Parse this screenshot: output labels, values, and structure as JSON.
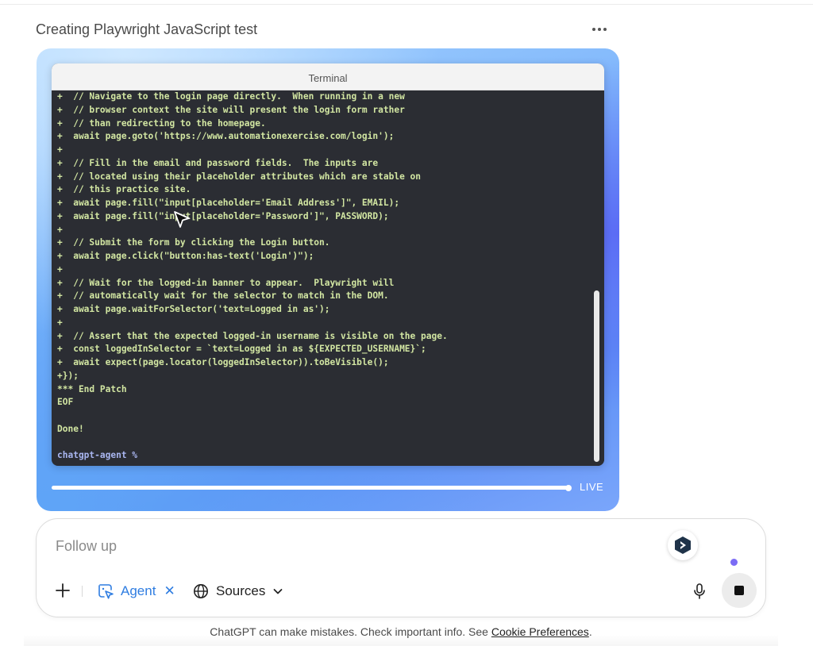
{
  "header": {
    "title": "Creating Playwright JavaScript test",
    "more_icon": "more-horizontal-icon"
  },
  "terminal": {
    "title": "Terminal",
    "lines": [
      "+  // Navigate to the login page directly.  When running in a new",
      "+  // browser context the site will present the login form rather",
      "+  // than redirecting to the homepage.",
      "+  await page.goto('https://www.automationexercise.com/login');",
      "+",
      "+  // Fill in the email and password fields.  The inputs are",
      "+  // located using their placeholder attributes which are stable on",
      "+  // this practice site.",
      "+  await page.fill(\"input[placeholder='Email Address']\", EMAIL);",
      "+  await page.fill(\"input[placeholder='Password']\", PASSWORD);",
      "+",
      "+  // Submit the form by clicking the Login button.",
      "+  await page.click(\"button:has-text('Login')\");",
      "+",
      "+  // Wait for the logged-in banner to appear.  Playwright will",
      "+  // automatically wait for the selector to match in the DOM.",
      "+  await page.waitForSelector('text=Logged in as');",
      "+",
      "+  // Assert that the expected logged-in username is visible on the page.",
      "+  const loggedInSelector = `text=Logged in as ${EXPECTED_USERNAME}`;",
      "+  await expect(page.locator(loggedInSelector)).toBeVisible();",
      "+});",
      "*** End Patch",
      "EOF",
      "",
      "Done!",
      ""
    ],
    "prompt": "chatgpt-agent %",
    "scroll_position": 0.98
  },
  "playback": {
    "live_label": "LIVE",
    "progress": 1.0
  },
  "composer": {
    "placeholder": "Follow up",
    "plus_icon": "plus-icon",
    "agent_label": "Agent",
    "agent_icon": "agent-cursor-icon",
    "agent_remove_icon": "close-icon",
    "sources_label": "Sources",
    "sources_icon": "globe-icon",
    "sources_chevron": "chevron-down-icon",
    "mic_icon": "microphone-icon",
    "stop_icon": "stop-icon",
    "extension_icon": "extension-logo-icon"
  },
  "footer": {
    "text": "ChatGPT can make mistakes. Check important info. See ",
    "link": "Cookie Preferences",
    "suffix": "."
  },
  "colors": {
    "accent": "#2f7de1",
    "terminal_bg": "#2b2d33",
    "terminal_text": "#d2e6a2",
    "prompt_text": "#a9b6f0"
  }
}
